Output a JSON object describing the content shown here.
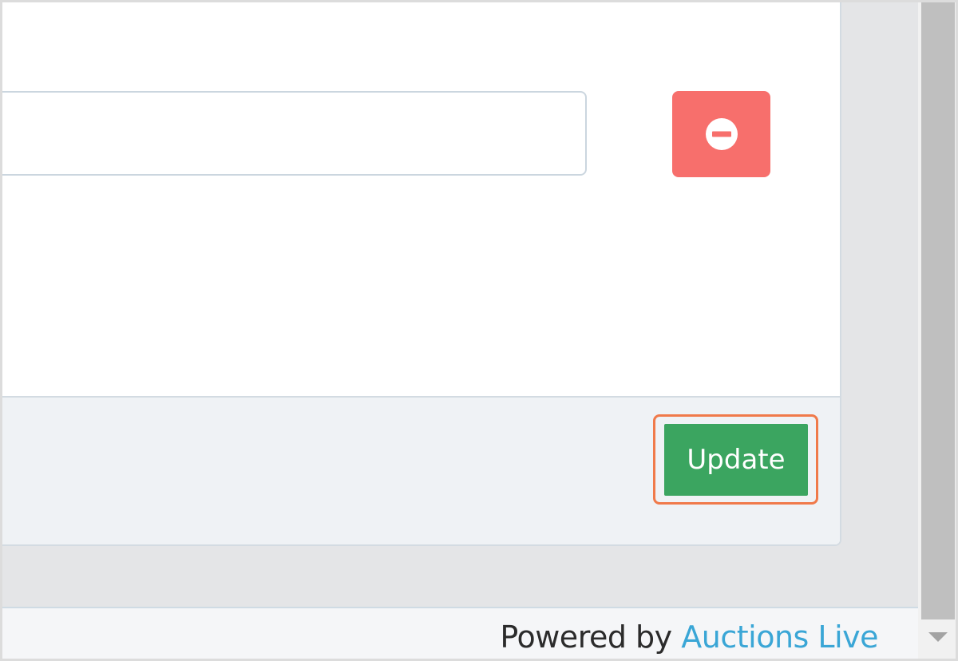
{
  "form": {
    "input_value": "",
    "input_placeholder": ""
  },
  "actions": {
    "remove_icon": "minus-circle-icon",
    "update_label": "Update"
  },
  "footer": {
    "powered_by_text": "Powered by",
    "brand_link_text": "Auctions Live"
  },
  "colors": {
    "remove_button": "#f76f6c",
    "update_button": "#3ba560",
    "focus_ring": "#f07a4a",
    "brand_link": "#3aa6d6"
  }
}
